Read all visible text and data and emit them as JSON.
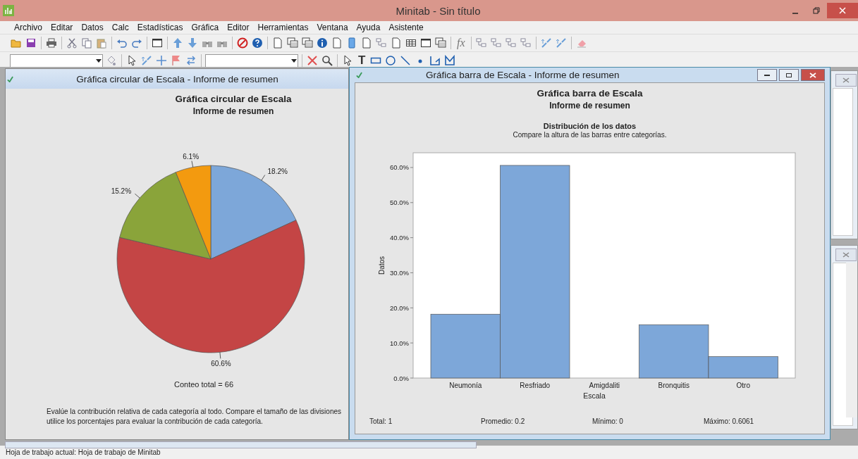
{
  "window": {
    "title": "Minitab - Sin título"
  },
  "menu": [
    "Archivo",
    "Editar",
    "Datos",
    "Calc",
    "Estadísticas",
    "Gráfica",
    "Editor",
    "Herramientas",
    "Ventana",
    "Ayuda",
    "Asistente"
  ],
  "toolbar": {
    "function_label": "fx",
    "text_tool_label": "T"
  },
  "pie_window": {
    "title": "Gráfica circular de Escala - Informe de resumen",
    "heading": "Gráfica circular de Escala",
    "subheading": "Informe de resumen",
    "chart_data": {
      "type": "pie",
      "values": [
        18.2,
        60.6,
        15.2,
        6.1
      ],
      "colors": [
        "#7da7d9",
        "#c44545",
        "#8aa43a",
        "#f39a0f"
      ],
      "value_labels": [
        "18.2%",
        "60.6%",
        "15.2%",
        "6.1%"
      ]
    },
    "total": "Conteo total = 66",
    "note_lines": [
      "Evalúe la contribución relativa de cada categoría al todo. Compare el tamaño de las divisiones",
      "utilice los porcentajes para evaluar la contribución de cada categoría."
    ]
  },
  "bar_window": {
    "title": "Gráfica barra de Escala - Informe de resumen",
    "heading": "Gráfica barra de Escala",
    "subheading": "Informe de resumen",
    "section_title": "Distribución de los datos",
    "section_hint": "Compare la altura de las barras entre categorías.",
    "chart_data": {
      "type": "bar",
      "xlabel": "Escala",
      "ylabel": "Datos",
      "categories": [
        "Neumonía",
        "Resfriado",
        "Amigdaliti",
        "Bronquitis",
        "Otro"
      ],
      "values": [
        0.182,
        0.606,
        0,
        0.152,
        0.061
      ],
      "color": "#7da7d9",
      "ylim": [
        0,
        0.642
      ],
      "yticks": [
        {
          "value": 0,
          "label": "0.0%"
        },
        {
          "value": 0.1,
          "label": "10.0%"
        },
        {
          "value": 0.2,
          "label": "20.0%"
        },
        {
          "value": 0.3,
          "label": "30.0%"
        },
        {
          "value": 0.4,
          "label": "40.0%"
        },
        {
          "value": 0.5,
          "label": "50.0%"
        },
        {
          "value": 0.6,
          "label": "60.0%"
        }
      ]
    },
    "stats": [
      "Total: 1",
      "Promedio: 0.2",
      "Mínimo: 0",
      "Máximo: 0.6061"
    ]
  },
  "status_bar": "Hoja de trabajo actual: Hoja de trabajo de Minitab"
}
